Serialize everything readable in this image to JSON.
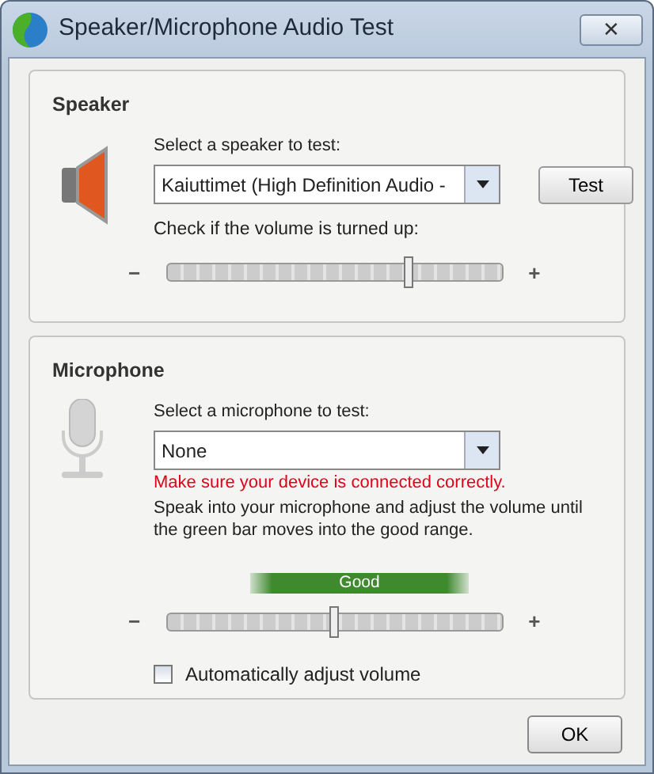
{
  "window": {
    "title": "Speaker/Microphone Audio Test",
    "close_glyph": "✕"
  },
  "speaker": {
    "heading": "Speaker",
    "select_label": "Select a speaker to test:",
    "device": "Kaiuttimet (High Definition Audio -",
    "test_button": "Test",
    "volume_label": "Check if the volume is turned up:",
    "minus": "−",
    "plus": "+",
    "level": 0.72
  },
  "microphone": {
    "heading": "Microphone",
    "select_label": "Select a microphone to test:",
    "device": "None",
    "error": "Make sure your device is connected correctly.",
    "instructions": "Speak into your microphone and adjust the volume until the green bar moves into the good range.",
    "range_label": "Good",
    "minus": "−",
    "plus": "+",
    "level": 0.5,
    "auto_adjust": {
      "label": "Automatically adjust volume",
      "checked": false
    }
  },
  "buttons": [
    "OK"
  ]
}
